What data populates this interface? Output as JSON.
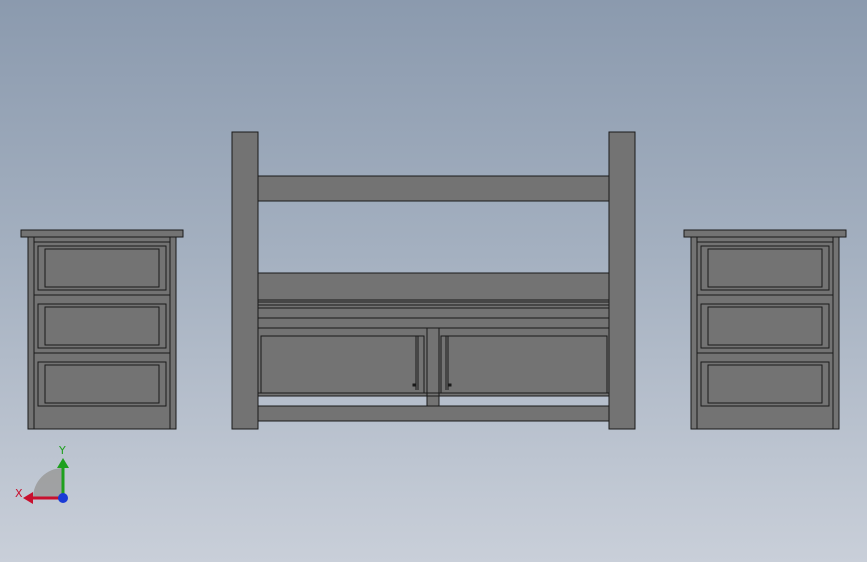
{
  "viewport": {
    "background_top": "#8b9aae",
    "background_bottom": "#c9cfd9"
  },
  "model": {
    "body_fill": "#737373",
    "edge_stroke": "#1a1a1a",
    "components": [
      "nightstand-left",
      "bed-headboard",
      "nightstand-right"
    ]
  },
  "triad": {
    "x_label": "X",
    "y_label": "Y",
    "x_color": "#c8102e",
    "y_color": "#1ea01e",
    "z_color": "#1a3bd6"
  }
}
